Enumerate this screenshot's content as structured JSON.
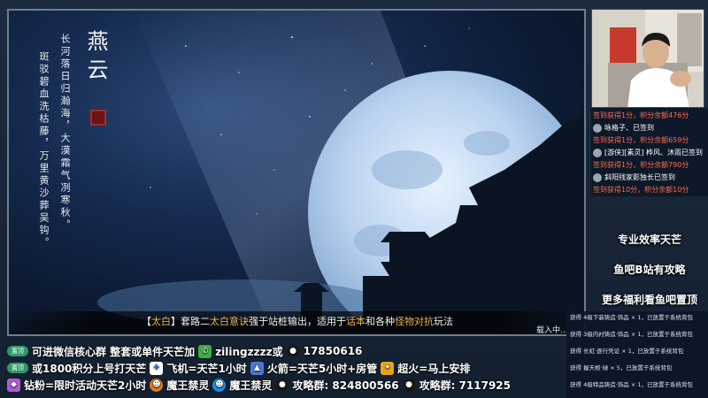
{
  "game": {
    "title": "燕云",
    "poem_line1": "长河落日归瀚海，大漠霜气冽寒秋。",
    "poem_line2": "斑驳碧血洗枯藤，万里黄沙葬吴钩。",
    "subtitle_open": "【",
    "subtitle_weapon": "太白",
    "subtitle_close": "】",
    "subtitle_p1": "套路二",
    "subtitle_h1": "太白意诀",
    "subtitle_p2": "强于站桩输出，适用于",
    "subtitle_h2": "话本",
    "subtitle_p3": "和各种",
    "subtitle_h3": "怪物对抗",
    "subtitle_p4": "玩法",
    "loading": "载入中..."
  },
  "feed": {
    "rows": [
      {
        "text": "签到获得1分，积分余额476分",
        "color": "red",
        "avatar": false
      },
      {
        "text": "咏格子、已签到",
        "color": "white",
        "avatar": true
      },
      {
        "text": "签到获得1分，积分余额659分",
        "color": "red",
        "avatar": false
      },
      {
        "text": "[游侠][素灵] 桦风、沐雨已签到",
        "color": "white",
        "avatar": true
      },
      {
        "text": "签到获得1分，积分余额790分",
        "color": "red",
        "avatar": false
      },
      {
        "text": "斜阳残家影独长已签到",
        "color": "white",
        "avatar": true
      },
      {
        "text": "签到获得10分，积分余额10分",
        "color": "red",
        "avatar": false
      }
    ]
  },
  "promos": [
    "专业效率天芒",
    "鱼吧B站有攻略",
    "更多福利看鱼吧置顶"
  ],
  "ticker": {
    "row1": {
      "pill": "置顶",
      "text1": "可进微信核心群 整套或单件天芒加",
      "wechat_icon": "wechat-icon",
      "wechat": "zilingzzzz或",
      "qq_icon": "qq-icon",
      "qq": "17850616"
    },
    "row2": {
      "pill": "置顶",
      "text1": "或1800积分上号打天芒",
      "plane": "飞机=天芒1小时",
      "rocket": "火箭=天芒5小时+房管",
      "fire": "超火=马上安排"
    },
    "row3": {
      "diamond": "钻粉=限时活动天芒2小时",
      "devil1": "魔王禁灵",
      "devil2": "魔王禁灵",
      "group1": "攻略群: 824800566",
      "group2": "攻略群: 7117925"
    }
  },
  "giftlog": {
    "entries": [
      "获得 4级下装铸造·饰品 × 1，已放置于系统背包",
      "获得 3级内衬铸造·饰品 × 1，已放置于系统背包",
      "获得 长虹·逐行凭证 × 1，已放置于系统背包",
      "获得 握天枢·绿 × 5，已放置于系统背包",
      "获得 4级特品铸造·饰品 × 1，已放置于系统背包"
    ]
  },
  "colors": {
    "accent_red": "#ff6a4d",
    "highlight_gold": "#e6b450"
  }
}
